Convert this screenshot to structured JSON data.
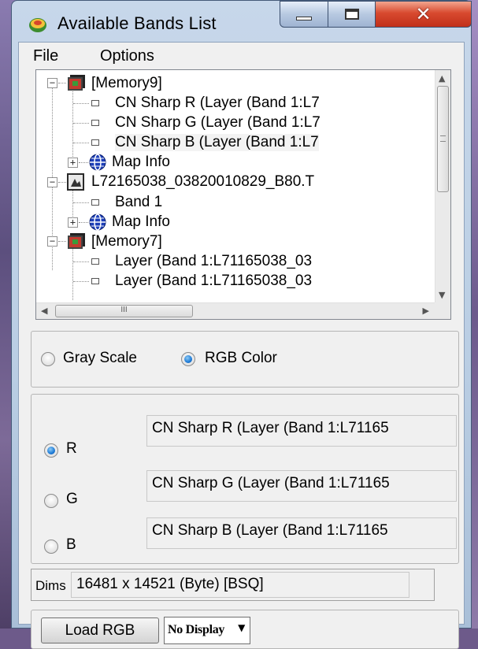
{
  "window": {
    "title": "Available Bands List",
    "controls": {
      "minimize": "minimize",
      "maximize": "maximize",
      "close": "✕"
    }
  },
  "menu": {
    "file": "File",
    "options": "Options"
  },
  "tree": {
    "items": [
      {
        "label": "[Memory9]"
      },
      {
        "label": "CN Sharp R (Layer (Band 1:L7"
      },
      {
        "label": "CN Sharp G (Layer (Band 1:L7"
      },
      {
        "label": "CN Sharp B (Layer (Band 1:L7"
      },
      {
        "label": "Map Info"
      },
      {
        "label": "L72165038_03820010829_B80.T"
      },
      {
        "label": "Band 1"
      },
      {
        "label": "Map Info"
      },
      {
        "label": "[Memory7]"
      },
      {
        "label": "Layer (Band 1:L71165038_03"
      },
      {
        "label": "Layer (Band 1:L71165038_03"
      }
    ],
    "hscroll_thumb": "III"
  },
  "mode": {
    "gray_scale": "Gray Scale",
    "rgb_color": "RGB Color",
    "selected": "RGB Color"
  },
  "bands": {
    "r": {
      "label": "R",
      "value": "CN Sharp R (Layer (Band 1:L71165",
      "checked": true
    },
    "g": {
      "label": "G",
      "value": "CN Sharp G (Layer (Band 1:L71165",
      "checked": false
    },
    "b": {
      "label": "B",
      "value": "CN Sharp B (Layer (Band 1:L71165",
      "checked": false
    }
  },
  "dims": {
    "label": "Dims",
    "value": "16481 x 14521 (Byte) [BSQ]"
  },
  "actions": {
    "load_button": "Load RGB",
    "display_select": "No Display"
  }
}
